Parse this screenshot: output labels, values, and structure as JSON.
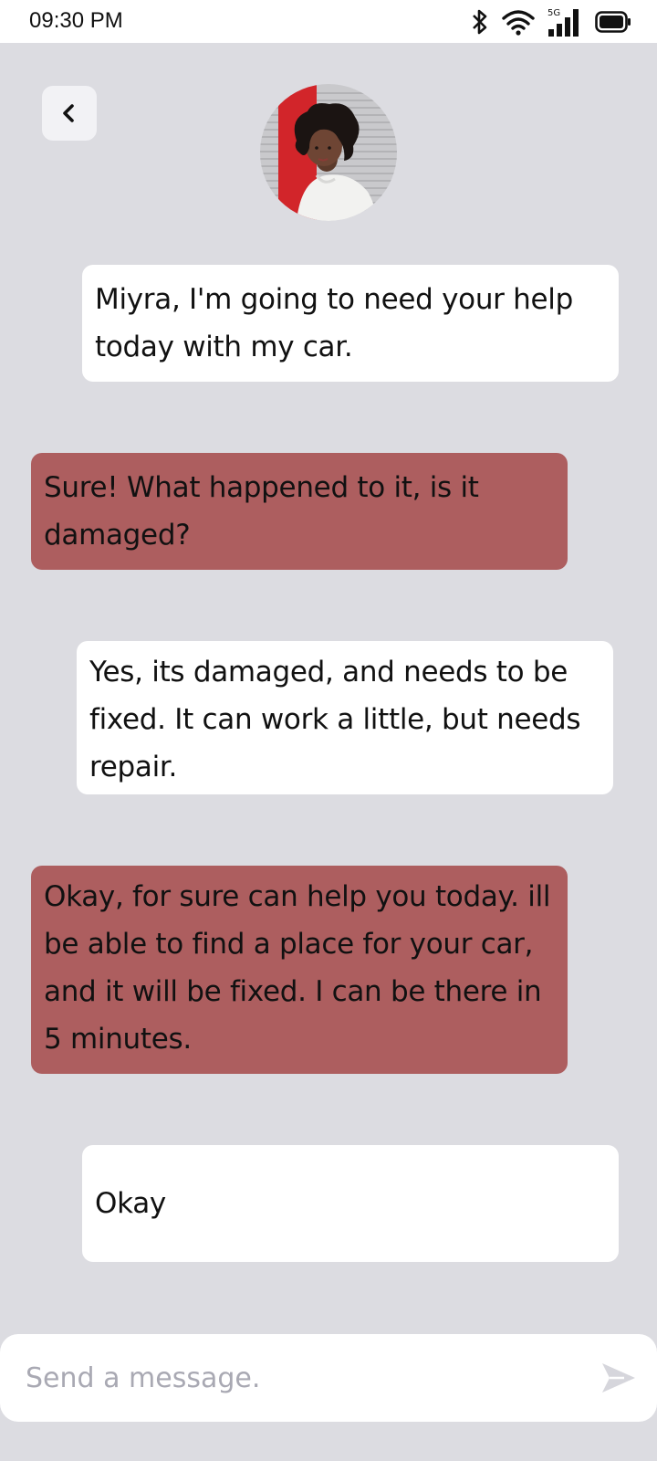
{
  "status_bar": {
    "time": "09:30 PM",
    "icons": [
      "bluetooth-icon",
      "wifi-icon",
      "signal-5g-icon",
      "battery-icon"
    ],
    "network_label": "5G"
  },
  "header": {
    "back_icon": "chevron-left-icon",
    "avatar_alt": "contact-avatar"
  },
  "messages": [
    {
      "side": "out",
      "text": "Miyra, I'm going to need your help today with my car."
    },
    {
      "side": "in",
      "text": "Sure! What happened to it, is it damaged?"
    },
    {
      "side": "out",
      "text": "Yes, its damaged, and needs to be fixed. It can work a little, but needs repair."
    },
    {
      "side": "in",
      "text": "Okay, for sure can help you today. ill be able to find a place for your car, and it will be fixed. I can be there in 5 minutes."
    },
    {
      "side": "out",
      "text": "Okay"
    }
  ],
  "composer": {
    "placeholder": "Send a message.",
    "value": "",
    "send_icon": "send-icon"
  },
  "colors": {
    "background": "#dcdce1",
    "outgoing_bubble": "#ffffff",
    "incoming_bubble": "#ad5e5f",
    "placeholder": "#a9a9b3"
  }
}
